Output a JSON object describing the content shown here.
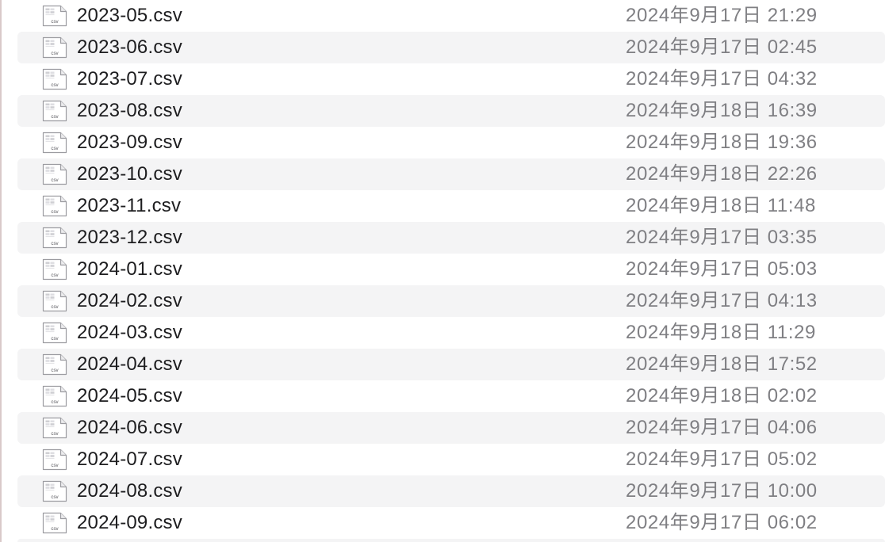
{
  "file_icon": "csv-file-icon",
  "icon_label": "csv",
  "files": [
    {
      "name": "2023-05.csv",
      "date": "2024年9月17日 21:29"
    },
    {
      "name": "2023-06.csv",
      "date": "2024年9月17日 02:45"
    },
    {
      "name": "2023-07.csv",
      "date": "2024年9月17日 04:32"
    },
    {
      "name": "2023-08.csv",
      "date": "2024年9月18日 16:39"
    },
    {
      "name": "2023-09.csv",
      "date": "2024年9月18日 19:36"
    },
    {
      "name": "2023-10.csv",
      "date": "2024年9月18日 22:26"
    },
    {
      "name": "2023-11.csv",
      "date": "2024年9月18日 11:48"
    },
    {
      "name": "2023-12.csv",
      "date": "2024年9月17日 03:35"
    },
    {
      "name": "2024-01.csv",
      "date": "2024年9月17日 05:03"
    },
    {
      "name": "2024-02.csv",
      "date": "2024年9月17日 04:13"
    },
    {
      "name": "2024-03.csv",
      "date": "2024年9月18日 11:29"
    },
    {
      "name": "2024-04.csv",
      "date": "2024年9月18日 17:52"
    },
    {
      "name": "2024-05.csv",
      "date": "2024年9月18日 02:02"
    },
    {
      "name": "2024-06.csv",
      "date": "2024年9月17日 04:06"
    },
    {
      "name": "2024-07.csv",
      "date": "2024年9月17日 05:02"
    },
    {
      "name": "2024-08.csv",
      "date": "2024年9月17日 10:00"
    },
    {
      "name": "2024-09.csv",
      "date": "2024年9月17日 06:02"
    }
  ]
}
